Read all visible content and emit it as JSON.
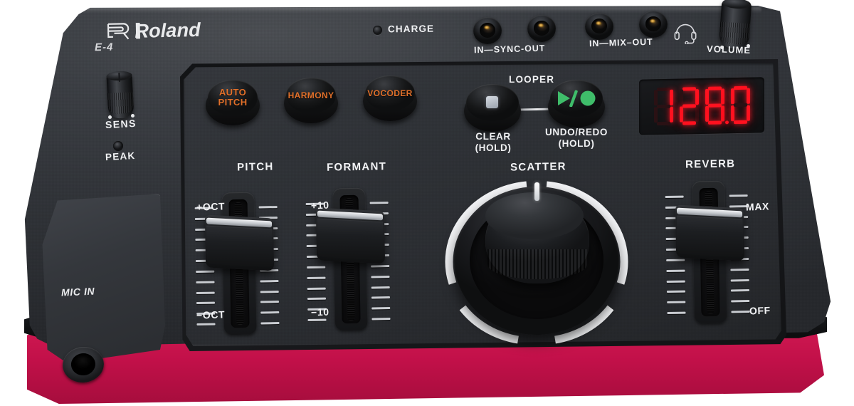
{
  "device": {
    "brand": "Roland",
    "model": "E-4",
    "colors": {
      "body": "#32353a",
      "base_red": "#c21049",
      "button_text_orange": "#e2702a",
      "led_red": "#ff1220",
      "looper_green": "#3fbd6a",
      "label_white": "#f2f3f5"
    }
  },
  "rear": {
    "charge_label": "CHARGE",
    "charge_led_name": "charge-led",
    "jacks": [
      {
        "name": "sync-in-jack"
      },
      {
        "name": "sync-out-jack"
      },
      {
        "name": "mix-in-jack"
      },
      {
        "name": "mix-out-jack"
      }
    ],
    "sync_label": "IN—SYNC-OUT",
    "mix_label": "IN—MIX–OUT",
    "headset_icon": "headset-icon",
    "volume_label": "VOLUME"
  },
  "left_side": {
    "sens_label": "SENS",
    "peak_label": "PEAK",
    "mic_in_label": "MIC IN"
  },
  "fx_buttons": [
    {
      "line1": "AUTO",
      "line2": "PITCH",
      "name": "auto-pitch-button"
    },
    {
      "line1": "HARMONY",
      "line2": "",
      "name": "harmony-button"
    },
    {
      "line1": "VOCODER",
      "line2": "",
      "name": "vocoder-button"
    }
  ],
  "looper": {
    "title": "LOOPER",
    "clear": {
      "line1": "CLEAR",
      "line2": "(HOLD)",
      "icon": "stop-square-icon"
    },
    "undo_redo": {
      "line1": "UNDO/REDO",
      "line2": "(HOLD)",
      "icon": "play-record-icon"
    }
  },
  "display": {
    "value": "128.0",
    "digits": [
      "1",
      "2",
      "8",
      "0"
    ],
    "decimal_after_index": 2,
    "type": "7-segment-led"
  },
  "controls": {
    "pitch": {
      "label": "PITCH",
      "top_label": "+OCT",
      "bottom_label": "−OCT",
      "value_pct": 78,
      "ticks": 12
    },
    "formant": {
      "label": "FORMANT",
      "top_label": "+10",
      "bottom_label": "−10",
      "value_pct": 80,
      "ticks": 12
    },
    "scatter": {
      "label": "SCATTER",
      "pointer_angle_deg": 0
    },
    "reverb": {
      "label": "REVERB",
      "top_label": "MAX",
      "bottom_label": "OFF",
      "value_pct": 76,
      "ticks": 12
    }
  }
}
